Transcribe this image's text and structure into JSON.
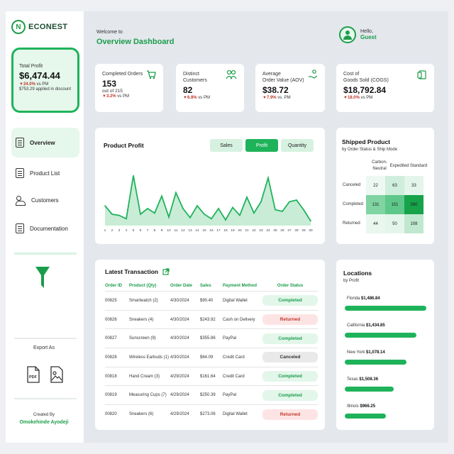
{
  "brand": {
    "name": "ECONEST",
    "mark": "N"
  },
  "profit_card": {
    "label": "Total Profit",
    "value": "$6,474.44",
    "change": "▼24.0%",
    "change_suffix": " vs PM",
    "discount": "$753.29 applied in discount"
  },
  "nav": [
    {
      "label": "Overview",
      "active": true
    },
    {
      "label": "Product List"
    },
    {
      "label": "Customers"
    },
    {
      "label": "Documentation"
    }
  ],
  "export": {
    "label": "Export As",
    "pdf_icon": "pdf-icon",
    "image_icon": "image-icon"
  },
  "credit": {
    "label": "Created By",
    "name": "Omokehinde Ayodeji"
  },
  "header": {
    "welcome": "Welcome to",
    "title": "Overview Dashboard",
    "hello": "Hello,",
    "user": "Guest"
  },
  "kpis": [
    {
      "title1": "Completed Orders",
      "title2": "",
      "value": "153",
      "sub": "out of 215",
      "change": "▼3.2%",
      "suffix": " vs PM",
      "icon": "cart-icon"
    },
    {
      "title1": "Distinct",
      "title2": "Customers",
      "value": "82",
      "sub": "",
      "change": "▼6.8%",
      "suffix": " vs PM",
      "icon": "people-icon"
    },
    {
      "title1": "Average",
      "title2": "Order Value (AOV)",
      "value": "$38.72",
      "sub": "",
      "change": "▼7.9%",
      "suffix": " vs. PM",
      "icon": "hand-coin-icon"
    },
    {
      "title1": "Cost of",
      "title2": "Goods Sold (COGS)",
      "value": "$18,792.84",
      "sub": "",
      "change": "▼18.0%",
      "suffix": " vs PM",
      "icon": "money-icon"
    }
  ],
  "product_profit": {
    "title": "Product Profit",
    "tabs": [
      "Sales",
      "Profit",
      "Quantity"
    ],
    "active_tab": "Profit"
  },
  "chart_data": {
    "type": "area",
    "title": "Product Profit",
    "x": [
      1,
      2,
      3,
      4,
      5,
      6,
      7,
      8,
      9,
      10,
      11,
      12,
      13,
      14,
      15,
      16,
      17,
      18,
      19,
      20,
      21,
      22,
      23,
      24,
      25,
      26,
      27,
      28,
      29,
      30
    ],
    "values": [
      35,
      20,
      18,
      12,
      88,
      20,
      30,
      22,
      52,
      15,
      58,
      30,
      14,
      35,
      20,
      12,
      30,
      10,
      32,
      18,
      50,
      22,
      42,
      84,
      28,
      25,
      42,
      45,
      28,
      8
    ],
    "ylim": [
      0,
      100
    ],
    "color": "#1eb35a",
    "fill": "#c9ecd7"
  },
  "shipped": {
    "title": "Shipped Product",
    "subtitle": "by Order Status & Ship Mode",
    "cols": [
      "Carbon-\nNeutral",
      "Expedited",
      "Standard"
    ],
    "rows": [
      "Canceled",
      "Completed",
      "Returned"
    ],
    "values": [
      [
        "22",
        "63",
        "33"
      ],
      [
        "131",
        "151",
        "390"
      ],
      [
        "44",
        "50",
        "108"
      ]
    ],
    "colors": [
      [
        "#eef8f2",
        "#cfeedb",
        "#e4f5eb"
      ],
      [
        "#7fd4a2",
        "#5ec88b",
        "#16a34a"
      ],
      [
        "#e9f7ef",
        "#e4f5eb",
        "#bfe8cf"
      ]
    ]
  },
  "transactions": {
    "title": "Latest Transaction",
    "headers": [
      "Order ID",
      "Product (Qty)",
      "Order Date",
      "Sales",
      "Payment Method",
      "Order Status"
    ],
    "rows": [
      [
        "00825",
        "Smartwatch (2)",
        "4/30/2024",
        "$90.40",
        "Digital Wallet",
        "Completed"
      ],
      [
        "00826",
        "Sneakers (4)",
        "4/30/2024",
        "$243.92",
        "Cash on Delivery",
        "Returned"
      ],
      [
        "00827",
        "Sunscreen (9)",
        "4/30/2024",
        "$355.86",
        "PayPal",
        "Completed"
      ],
      [
        "00828",
        "Wireless Earbuds (1)",
        "4/30/2024",
        "$64.09",
        "Credit Card",
        "Canceled"
      ],
      [
        "00818",
        "Hand Cream (3)",
        "4/29/2024",
        "$161.64",
        "Credit Card",
        "Completed"
      ],
      [
        "00819",
        "Measuring Cups (7)",
        "4/29/2024",
        "$250.39",
        "PayPal",
        "Completed"
      ],
      [
        "00820",
        "Sneakers (6)",
        "4/29/2024",
        "$273.06",
        "Digital Wallet",
        "Returned"
      ]
    ]
  },
  "locations": {
    "title": "Locations",
    "subtitle": "by Profit",
    "items": [
      {
        "name": "Florida",
        "value": "$1,486.84",
        "pct": 1.0
      },
      {
        "name": "California",
        "value": "$1,434.85",
        "pct": 0.88
      },
      {
        "name": "New York",
        "value": "$1,078.14",
        "pct": 0.76
      },
      {
        "name": "Texas",
        "value": "$1,508.36",
        "pct": 0.6
      },
      {
        "name": "Illinois",
        "value": "$966.25",
        "pct": 0.5
      }
    ]
  }
}
